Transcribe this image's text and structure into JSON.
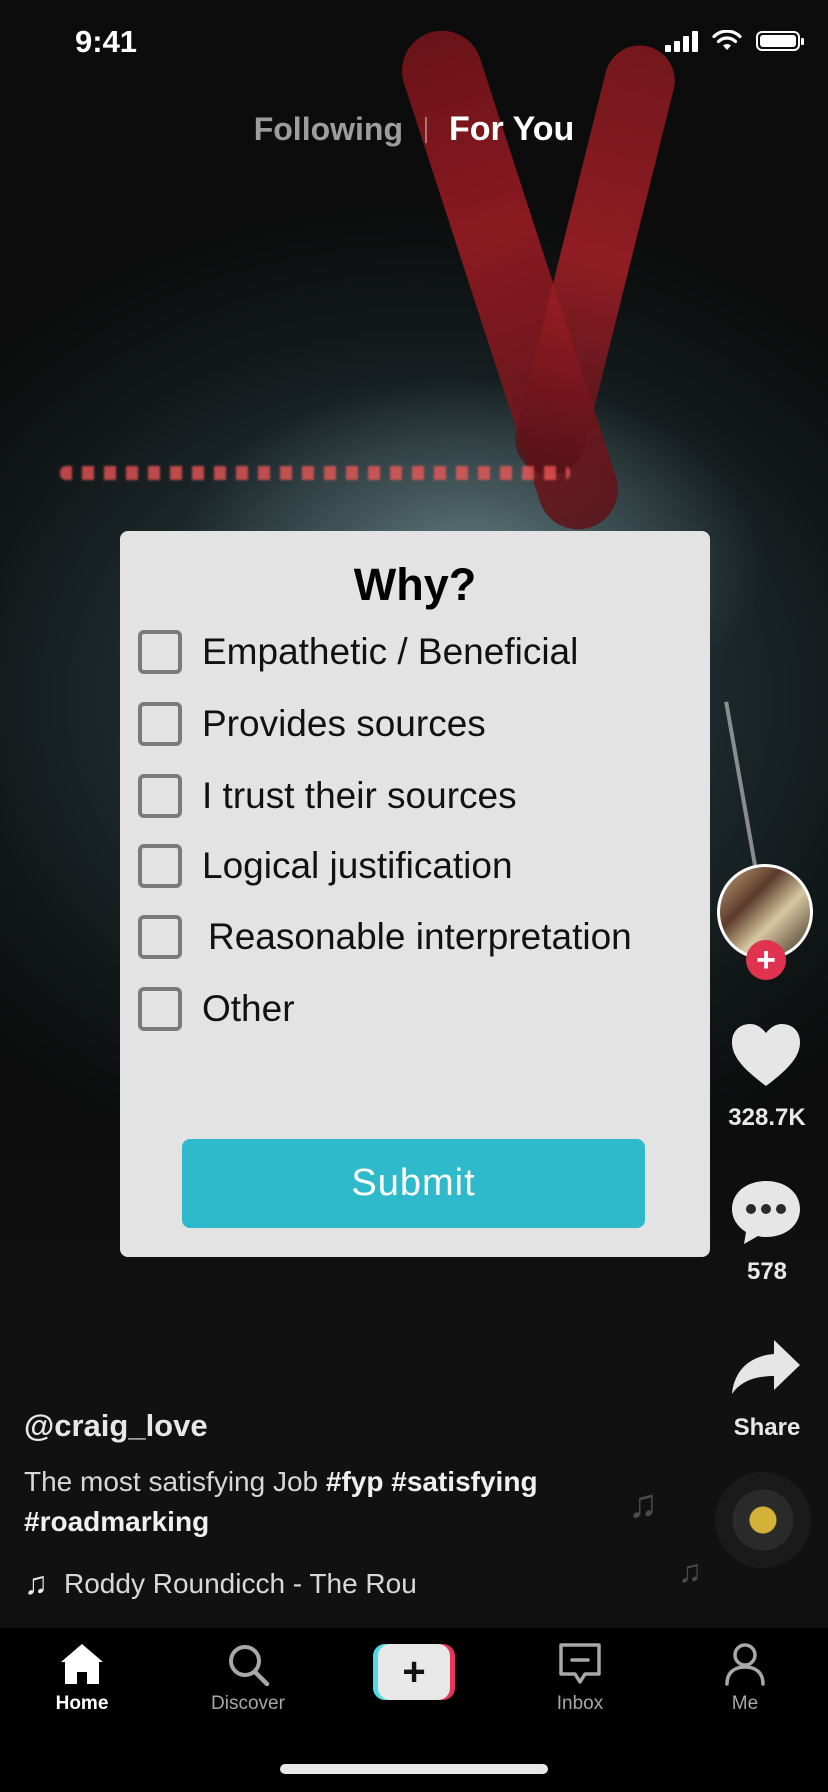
{
  "status_bar": {
    "time": "9:41"
  },
  "top_tabs": {
    "following": "Following",
    "for_you": "For You",
    "active": "For You"
  },
  "dialog": {
    "title": "Why?",
    "options": [
      {
        "label": "Empathetic / Beneficial",
        "checked": false
      },
      {
        "label": "Provides sources",
        "checked": false
      },
      {
        "label": "I trust their sources",
        "checked": false
      },
      {
        "label": "Logical justification",
        "checked": false
      },
      {
        "label": "Reasonable interpretation",
        "checked": false
      },
      {
        "label": "Other",
        "checked": false
      }
    ],
    "submit_label": "Submit",
    "accent_color": "#2ebacb"
  },
  "rail": {
    "likes": "328.7K",
    "comments": "578",
    "share_label": "Share",
    "follow_color": "#e0334f"
  },
  "post": {
    "username": "@craig_love",
    "caption_text": "The most satisfying Job ",
    "hashtags": [
      "#fyp",
      "#satisfying",
      "#roadmarking"
    ],
    "music": "Roddy Roundicch - The Rou"
  },
  "nav": {
    "items": [
      {
        "label": "Home",
        "icon": "home-icon",
        "active": true
      },
      {
        "label": "Discover",
        "icon": "search-icon",
        "active": false
      },
      {
        "label": "",
        "icon": "add-icon",
        "active": false
      },
      {
        "label": "Inbox",
        "icon": "inbox-icon",
        "active": false
      },
      {
        "label": "Me",
        "icon": "profile-icon",
        "active": false
      }
    ]
  }
}
